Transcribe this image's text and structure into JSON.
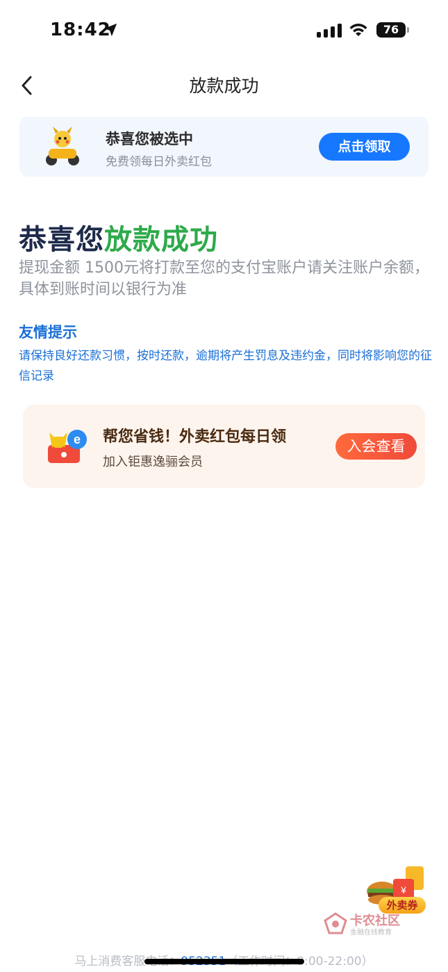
{
  "status_bar": {
    "time": "18:42",
    "battery": "76",
    "icons": [
      "location-arrow-icon",
      "signal-icon",
      "wifi-icon",
      "battery-icon"
    ]
  },
  "nav": {
    "title": "放款成功",
    "back_icon": "chevron-left-icon"
  },
  "top_banner": {
    "title": "恭喜您被选中",
    "subtitle": "免费领每日外卖红包",
    "button": "点击领取",
    "accent": "#1677ff"
  },
  "headline": {
    "prefix": "恭喜您",
    "highlight": "放款成功",
    "highlight_color": "#2eaa4a"
  },
  "description": "提现金额 1500元将打款至您的支付宝账户请关注账户余额，具体到账时间以银行为准",
  "tip": {
    "title": "友情提示",
    "text": "请保持良好还款习惯，按时还款，逾期将产生罚息及违约金，同时将影响您的征信记录"
  },
  "promo_banner": {
    "title": "帮您省钱！外卖红包每日领",
    "subtitle": "加入钜惠逸骊会员",
    "button": "入会查看"
  },
  "floating_coupon": {
    "label": "外卖券"
  },
  "watermark": {
    "title": "卡农社区",
    "subtitle": "金融在线教育"
  },
  "footer": {
    "prefix": "马上消费客服电话：",
    "phone": "952351",
    "suffix": "（工作时间：9:00-22:00）"
  }
}
